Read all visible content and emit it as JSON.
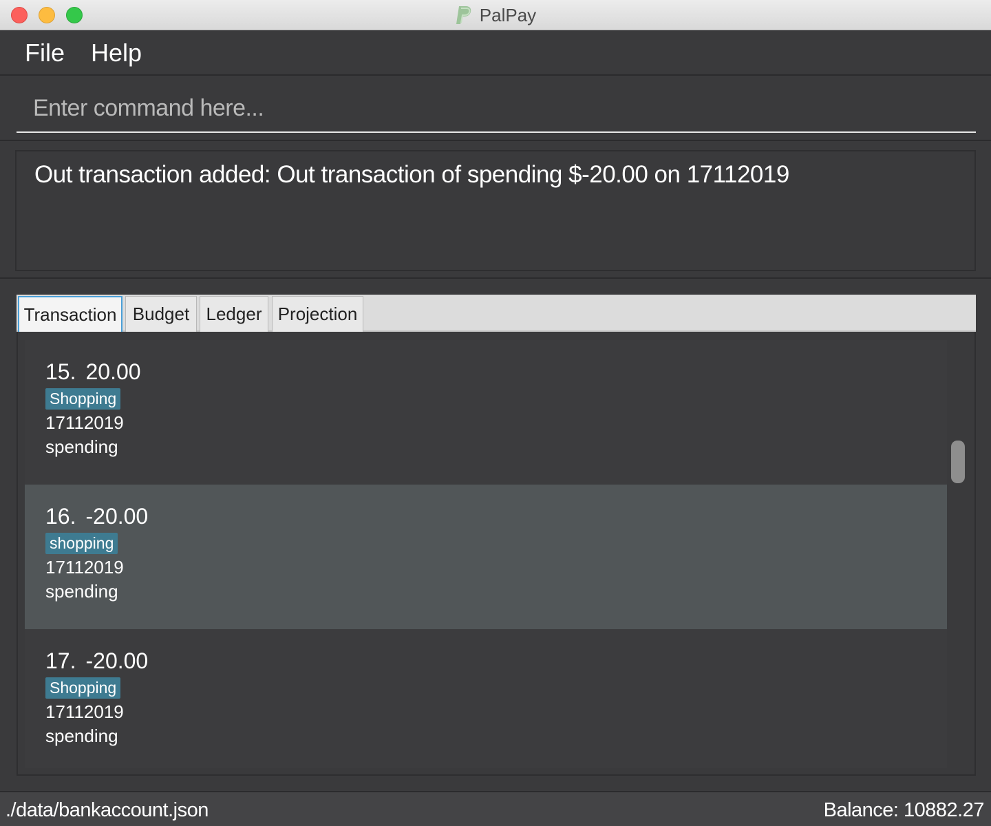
{
  "window": {
    "title": "PalPay",
    "app_icon": "paypal-p-logo-icon"
  },
  "menu": {
    "items": [
      {
        "label": "File"
      },
      {
        "label": "Help"
      }
    ]
  },
  "command": {
    "value": "",
    "placeholder": "Enter command here..."
  },
  "result": {
    "message": "Out transaction added: Out transaction of spending $-20.00 on 17112019"
  },
  "tabs": {
    "items": [
      {
        "label": "Transaction",
        "active": true
      },
      {
        "label": "Budget",
        "active": false
      },
      {
        "label": "Ledger",
        "active": false
      },
      {
        "label": "Projection",
        "active": false
      }
    ]
  },
  "transactions": [
    {
      "index": "15.",
      "amount": "20.00",
      "category": "Shopping",
      "date": "17112019",
      "description": "spending",
      "selected": false
    },
    {
      "index": "16.",
      "amount": "-20.00",
      "category": "shopping",
      "date": "17112019",
      "description": "spending",
      "selected": true
    },
    {
      "index": "17.",
      "amount": "-20.00",
      "category": "Shopping",
      "date": "17112019",
      "description": "spending",
      "selected": false
    }
  ],
  "status": {
    "file_path": "./data/bankaccount.json",
    "balance": "Balance: 10882.27"
  },
  "colors": {
    "background": "#3a3a3c",
    "selected_row": "#515658",
    "tag": "#3e7b91",
    "active_tab_border": "#4a9fd8"
  }
}
